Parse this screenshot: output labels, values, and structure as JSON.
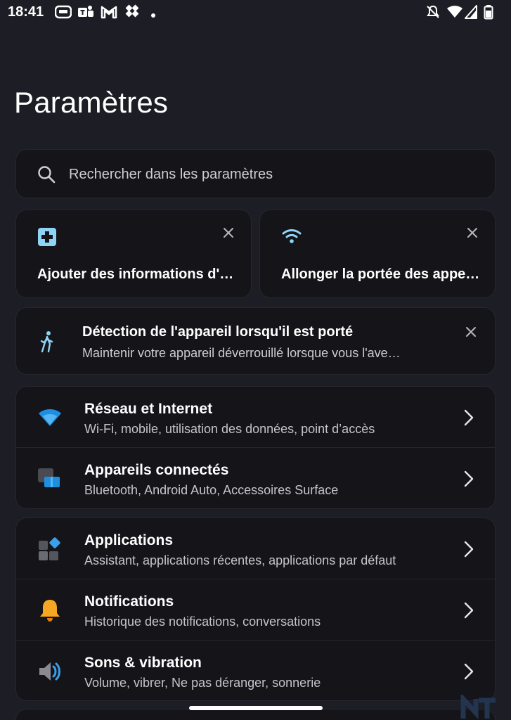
{
  "status_bar": {
    "time": "18:41",
    "left_icons": [
      "app-icon",
      "teams-icon",
      "gmail-icon",
      "dropbox-icon",
      "dot-icon"
    ],
    "right_icons": [
      "notifications-off-icon",
      "wifi-icon",
      "cell-signal-icon",
      "battery-icon"
    ]
  },
  "page": {
    "title": "Paramètres"
  },
  "search": {
    "placeholder": "Rechercher dans les paramètres"
  },
  "suggestions": [
    {
      "icon": "medical-info-icon",
      "title": "Ajouter des informations d'…",
      "accent": "#8fd4f5"
    },
    {
      "icon": "wifi-calling-icon",
      "title": "Allonger la portée des appel…",
      "accent": "#8fd4f5"
    }
  ],
  "wide_suggestion": {
    "icon": "walking-person-icon",
    "title": "Détection de l'appareil lorsqu'il est porté",
    "subtitle": "Maintenir votre appareil déverrouillé lorsque vous l'ave…"
  },
  "groups": [
    {
      "items": [
        {
          "icon": "wifi-icon",
          "title": "Réseau et Internet",
          "subtitle": "Wi-Fi, mobile, utilisation des données, point d’accès"
        },
        {
          "icon": "connected-devices-icon",
          "title": "Appareils connectés",
          "subtitle": "Bluetooth, Android Auto, Accessoires Surface"
        }
      ]
    },
    {
      "items": [
        {
          "icon": "apps-icon",
          "title": "Applications",
          "subtitle": "Assistant, applications récentes, applications par défaut"
        },
        {
          "icon": "bell-icon",
          "title": "Notifications",
          "subtitle": "Historique des notifications, conversations"
        },
        {
          "icon": "speaker-icon",
          "title": "Sons & vibration",
          "subtitle": "Volume, vibrer, Ne pas déranger, sonnerie"
        }
      ]
    }
  ],
  "colors": {
    "background": "#1d1d25",
    "card": "#141419",
    "accent_blue": "#3aa0e8",
    "accent_light_blue": "#8fd4f5",
    "bell": "#f5a623"
  }
}
